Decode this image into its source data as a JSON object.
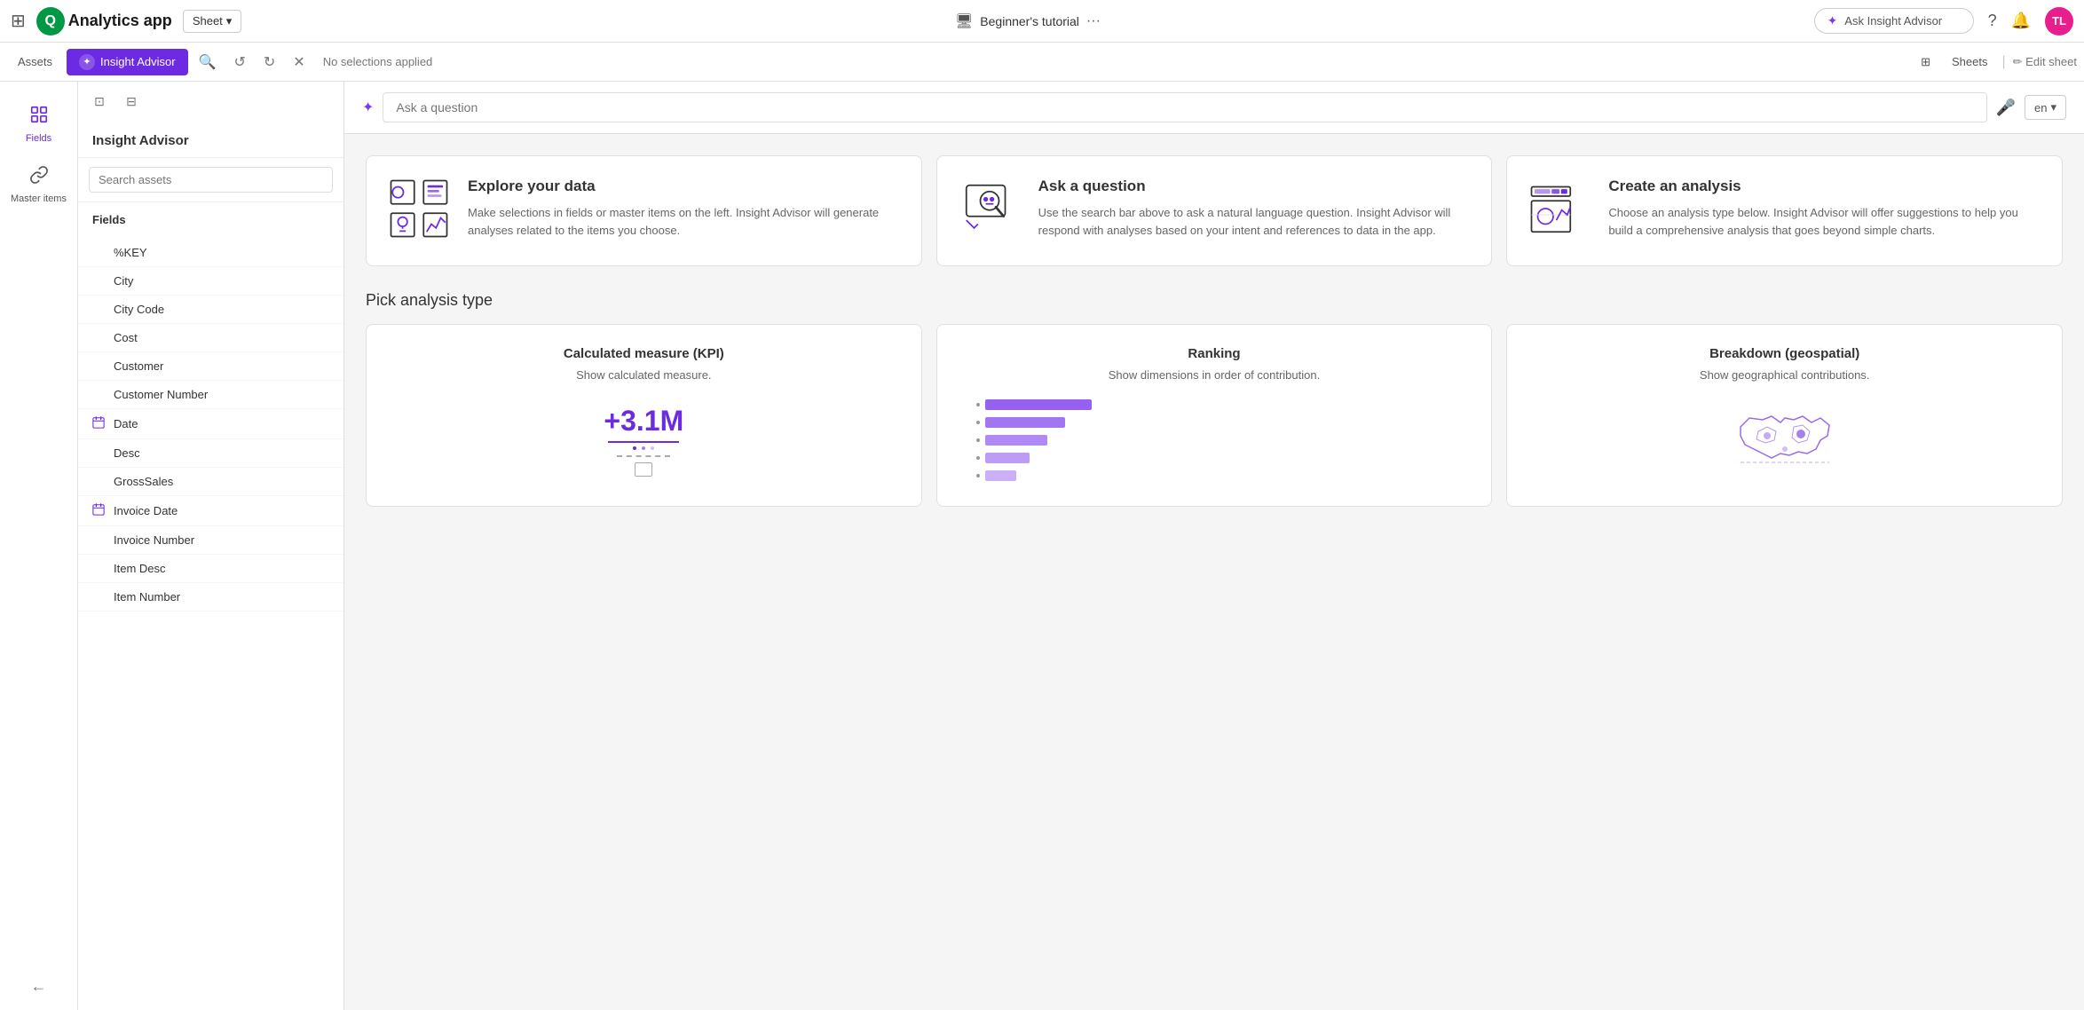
{
  "app": {
    "name": "Analytics app",
    "grid_icon": "⊞",
    "logo_letter": "Q",
    "sheet_selector": "Sheet"
  },
  "nav_center": {
    "tutorial_icon": "🖥",
    "tutorial_label": "Beginner's tutorial",
    "more_icon": "···"
  },
  "nav_right": {
    "ask_placeholder": "Ask Insight Advisor",
    "help_icon": "?",
    "notif_icon": "🔔",
    "user_initials": "TL"
  },
  "toolbar": {
    "assets_label": "Assets",
    "insight_label": "Insight Advisor",
    "no_selection": "No selections applied",
    "sheets_label": "Sheets",
    "edit_sheet_label": "Edit sheet"
  },
  "left_panel": {
    "items": [
      {
        "id": "fields",
        "icon": "☰",
        "label": "Fields",
        "active": true
      },
      {
        "id": "master-items",
        "icon": "🔗",
        "label": "Master items",
        "active": false
      }
    ]
  },
  "ia_panel": {
    "title": "Insight Advisor",
    "search_placeholder": "Search assets",
    "fields_header": "Fields",
    "fields": [
      {
        "id": "%KEY",
        "label": "%KEY",
        "has_icon": false
      },
      {
        "id": "City",
        "label": "City",
        "has_icon": false
      },
      {
        "id": "City Code",
        "label": "City Code",
        "has_icon": false
      },
      {
        "id": "Cost",
        "label": "Cost",
        "has_icon": false
      },
      {
        "id": "Customer",
        "label": "Customer",
        "has_icon": false
      },
      {
        "id": "Customer Number",
        "label": "Customer Number",
        "has_icon": false
      },
      {
        "id": "Date",
        "label": "Date",
        "has_icon": true
      },
      {
        "id": "Desc",
        "label": "Desc",
        "has_icon": false
      },
      {
        "id": "GrossSales",
        "label": "GrossSales",
        "has_icon": false
      },
      {
        "id": "Invoice Date",
        "label": "Invoice Date",
        "has_icon": true
      },
      {
        "id": "Invoice Number",
        "label": "Invoice Number",
        "has_icon": false
      },
      {
        "id": "Item Desc",
        "label": "Item Desc",
        "has_icon": false
      },
      {
        "id": "Item Number",
        "label": "Item Number",
        "has_icon": false
      }
    ]
  },
  "question_bar": {
    "placeholder": "Ask a question",
    "lang": "en"
  },
  "info_cards": [
    {
      "id": "explore",
      "title": "Explore your data",
      "text": "Make selections in fields or master items on the left. Insight Advisor will generate analyses related to the items you choose."
    },
    {
      "id": "ask",
      "title": "Ask a question",
      "text": "Use the search bar above to ask a natural language question. Insight Advisor will respond with analyses based on your intent and references to data in the app."
    },
    {
      "id": "create",
      "title": "Create an analysis",
      "text": "Choose an analysis type below. Insight Advisor will offer suggestions to help you build a comprehensive analysis that goes beyond simple charts."
    }
  ],
  "analysis_section": {
    "title": "Pick analysis type",
    "cards": [
      {
        "id": "kpi",
        "title": "Calculated measure (KPI)",
        "desc": "Show calculated measure.",
        "value": "+3.1M"
      },
      {
        "id": "ranking",
        "title": "Ranking",
        "desc": "Show dimensions in order of contribution."
      },
      {
        "id": "geospatial",
        "title": "Breakdown (geospatial)",
        "desc": "Show geographical contributions."
      }
    ]
  }
}
